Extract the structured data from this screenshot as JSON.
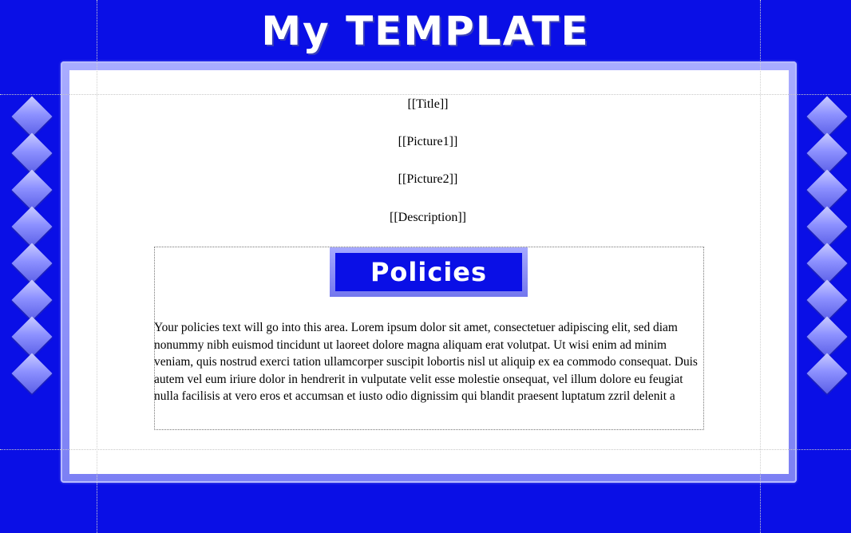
{
  "header": {
    "title": "My TEMPLATE"
  },
  "placeholders": {
    "title": "[[Title]]",
    "picture1": "[[Picture1]]",
    "picture2": "[[Picture2]]",
    "description": "[[Description]]"
  },
  "policies": {
    "heading": "Policies",
    "text": "Your policies text will go into this area. Lorem ipsum dolor sit amet, consectetuer adipiscing elit, sed diam nonummy nibh euismod tincidunt ut laoreet dolore magna aliquam erat volutpat. Ut wisi enim ad minim veniam, quis nostrud exerci tation ullamcorper suscipit lobortis nisl ut aliquip ex ea commodo consequat. Duis autem vel eum iriure dolor in hendrerit in vulputate velit esse molestie onsequat, vel illum dolore eu feugiat nulla facilisis at vero eros et accumsan et iusto odio dignissim qui blandit praesent luptatum zzril delenit a"
  },
  "colors": {
    "background": "#0a0fe6",
    "frame": "#8f93fa",
    "content": "#ffffff",
    "diamond": "#8d91ff"
  },
  "icons": {
    "decoration": "diamond-icon"
  }
}
